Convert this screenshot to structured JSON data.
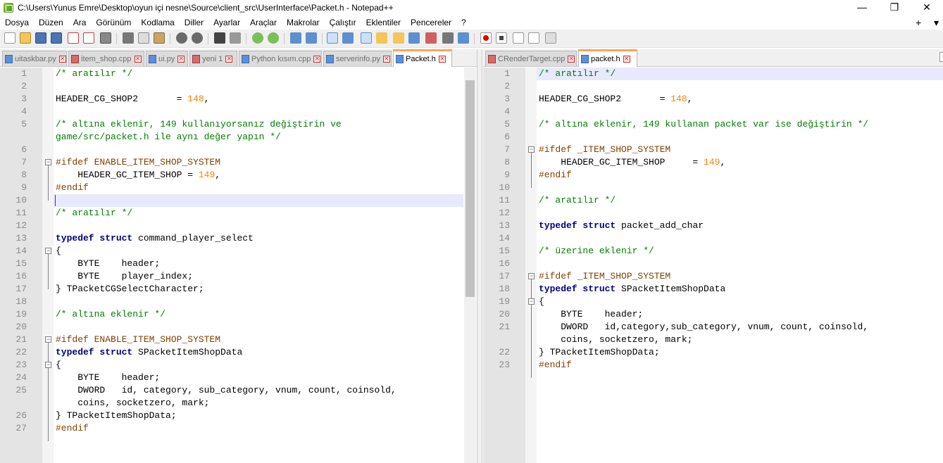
{
  "window": {
    "title": "C:\\Users\\Yunus Emre\\Desktop\\oyun içi nesne\\Source\\client_src\\UserInterface\\Packet.h - Notepad++",
    "minimize": "—",
    "restore": "❐",
    "close": "✕"
  },
  "menu": {
    "items": [
      "Dosya",
      "Düzen",
      "Ara",
      "Görünüm",
      "Kodlama",
      "Diller",
      "Ayarlar",
      "Araçlar",
      "Makrolar",
      "Çalıştır",
      "Eklentiler",
      "Pencereler",
      "?"
    ],
    "plus": "+",
    "down": "▾",
    "close": "✕"
  },
  "tabs_left": [
    {
      "label": "uitaskbar.py",
      "active": false
    },
    {
      "label": "item_shop.cpp",
      "active": false
    },
    {
      "label": "ui.py",
      "active": false
    },
    {
      "label": "yeni 1",
      "active": false
    },
    {
      "label": "Python kısım.cpp",
      "active": false
    },
    {
      "label": "serverinfo.py",
      "active": false
    },
    {
      "label": "Packet.h",
      "active": true
    }
  ],
  "tabs_right": [
    {
      "label": "CRenderTarget.cpp",
      "active": false
    },
    {
      "label": "packet.h",
      "active": true
    }
  ],
  "left_editor": {
    "lines": [
      {
        "n": "1",
        "t": "/* aratılır */"
      },
      {
        "n": "2",
        "t": ""
      },
      {
        "n": "3",
        "t": "HEADER_CG_SHOP2       = 148,"
      },
      {
        "n": "4",
        "t": ""
      },
      {
        "n": "5",
        "t": "/* altına eklenir, 149 kullanıyorsanız değiştirin ve"
      },
      {
        "n": "",
        "t": "game/src/packet.h ile aynı değer yapın */"
      },
      {
        "n": "6",
        "t": ""
      },
      {
        "n": "7",
        "t": "#ifdef ENABLE_ITEM_SHOP_SYSTEM"
      },
      {
        "n": "8",
        "t": "    HEADER_GC_ITEM_SHOP = 149,"
      },
      {
        "n": "9",
        "t": "#endif"
      },
      {
        "n": "10",
        "t": ""
      },
      {
        "n": "11",
        "t": "/* aratılır */"
      },
      {
        "n": "12",
        "t": ""
      },
      {
        "n": "13",
        "t": "typedef struct command_player_select"
      },
      {
        "n": "14",
        "t": "{"
      },
      {
        "n": "15",
        "t": "    BYTE    header;"
      },
      {
        "n": "16",
        "t": "    BYTE    player_index;"
      },
      {
        "n": "17",
        "t": "} TPacketCGSelectCharacter;"
      },
      {
        "n": "18",
        "t": ""
      },
      {
        "n": "19",
        "t": "/* altına eklenir */"
      },
      {
        "n": "20",
        "t": ""
      },
      {
        "n": "21",
        "t": "#ifdef ENABLE_ITEM_SHOP_SYSTEM"
      },
      {
        "n": "22",
        "t": "typedef struct SPacketItemShopData"
      },
      {
        "n": "23",
        "t": "{"
      },
      {
        "n": "24",
        "t": "    BYTE    header;"
      },
      {
        "n": "25",
        "t": "    DWORD   id, category, sub_category, vnum, count, coinsold,"
      },
      {
        "n": "",
        "t": "    coins, socketzero, mark;"
      },
      {
        "n": "26",
        "t": "} TPacketItemShopData;"
      },
      {
        "n": "27",
        "t": "#endif"
      }
    ]
  },
  "right_editor": {
    "lines": [
      {
        "n": "1",
        "t": "/* aratılır */"
      },
      {
        "n": "2",
        "t": ""
      },
      {
        "n": "3",
        "t": "HEADER_CG_SHOP2       = 148,"
      },
      {
        "n": "4",
        "t": ""
      },
      {
        "n": "5",
        "t": "/* altına eklenir, 149 kullanan packet var ise değiştirin */"
      },
      {
        "n": "6",
        "t": ""
      },
      {
        "n": "7",
        "t": "#ifdef _ITEM_SHOP_SYSTEM"
      },
      {
        "n": "8",
        "t": "    HEADER_GC_ITEM_SHOP     = 149,"
      },
      {
        "n": "9",
        "t": "#endif"
      },
      {
        "n": "10",
        "t": ""
      },
      {
        "n": "11",
        "t": "/* aratılır */"
      },
      {
        "n": "12",
        "t": ""
      },
      {
        "n": "13",
        "t": "typedef struct packet_add_char"
      },
      {
        "n": "14",
        "t": ""
      },
      {
        "n": "15",
        "t": "/* üzerine eklenir */"
      },
      {
        "n": "16",
        "t": ""
      },
      {
        "n": "17",
        "t": "#ifdef _ITEM_SHOP_SYSTEM"
      },
      {
        "n": "18",
        "t": "typedef struct SPacketItemShopData"
      },
      {
        "n": "19",
        "t": "{"
      },
      {
        "n": "20",
        "t": "    BYTE    header;"
      },
      {
        "n": "21",
        "t": "    DWORD   id,category,sub_category, vnum, count, coinsold,"
      },
      {
        "n": "",
        "t": "    coins, socketzero, mark;"
      },
      {
        "n": "22",
        "t": "} TPacketItemShopData;"
      },
      {
        "n": "23",
        "t": "#endif"
      }
    ]
  }
}
